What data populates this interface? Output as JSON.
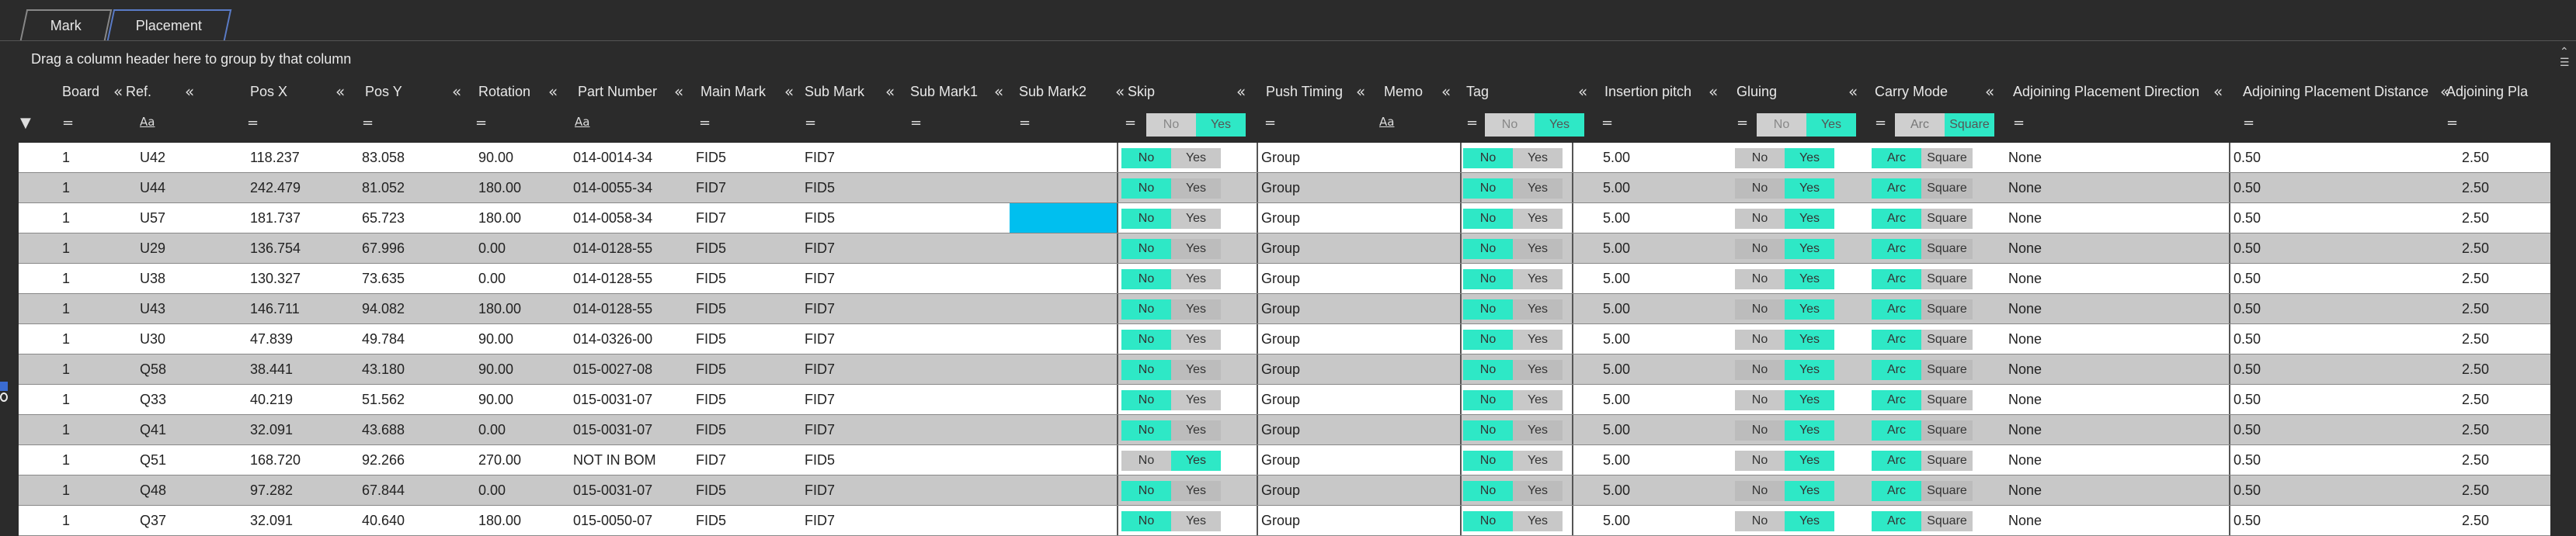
{
  "tabs": [
    {
      "label": "Mark"
    },
    {
      "label": "Placement"
    }
  ],
  "group_hint": "Drag a column header here to group by that column",
  "columns": [
    "Board",
    "Ref.",
    "Pos X",
    "Pos Y",
    "Rotation",
    "Part Number",
    "Main Mark",
    "Sub Mark",
    "Sub Mark1",
    "Sub Mark2",
    "Skip",
    "Push Timing",
    "Memo",
    "Tag",
    "Insertion pitch",
    "Gluing",
    "Carry Mode",
    "Adjoining Placement Direction",
    "Adjoining Placement Distance",
    "Adjoining Pla"
  ],
  "filter_row": {
    "text_filter_glyph": "Aa",
    "equals_glyph": "=",
    "no": "No",
    "yes": "Yes",
    "arc": "Arc",
    "square": "Square"
  },
  "row_labels": {
    "no": "No",
    "yes": "Yes",
    "arc": "Arc",
    "square": "Square"
  },
  "rows": [
    {
      "board": "1",
      "ref": "U42",
      "posx": "118.237",
      "posy": "83.058",
      "rot": "90.00",
      "part": "014-0014-34",
      "main": "FID5",
      "sub": "FID7",
      "skip": "No",
      "push": "Group",
      "tag": "No",
      "pitch": "5.00",
      "glue": "Yes",
      "carry": "Arc",
      "dir": "None",
      "dist": "0.50",
      "pla": "2.50",
      "sub2_highlight": false
    },
    {
      "board": "1",
      "ref": "U44",
      "posx": "242.479",
      "posy": "81.052",
      "rot": "180.00",
      "part": "014-0055-34",
      "main": "FID7",
      "sub": "FID5",
      "skip": "No",
      "push": "Group",
      "tag": "No",
      "pitch": "5.00",
      "glue": "Yes",
      "carry": "Arc",
      "dir": "None",
      "dist": "0.50",
      "pla": "2.50",
      "sub2_highlight": false
    },
    {
      "board": "1",
      "ref": "U57",
      "posx": "181.737",
      "posy": "65.723",
      "rot": "180.00",
      "part": "014-0058-34",
      "main": "FID7",
      "sub": "FID5",
      "skip": "No",
      "push": "Group",
      "tag": "No",
      "pitch": "5.00",
      "glue": "Yes",
      "carry": "Arc",
      "dir": "None",
      "dist": "0.50",
      "pla": "2.50",
      "sub2_highlight": true
    },
    {
      "board": "1",
      "ref": "U29",
      "posx": "136.754",
      "posy": "67.996",
      "rot": "0.00",
      "part": "014-0128-55",
      "main": "FID5",
      "sub": "FID7",
      "skip": "No",
      "push": "Group",
      "tag": "No",
      "pitch": "5.00",
      "glue": "Yes",
      "carry": "Arc",
      "dir": "None",
      "dist": "0.50",
      "pla": "2.50",
      "sub2_highlight": false
    },
    {
      "board": "1",
      "ref": "U38",
      "posx": "130.327",
      "posy": "73.635",
      "rot": "0.00",
      "part": "014-0128-55",
      "main": "FID5",
      "sub": "FID7",
      "skip": "No",
      "push": "Group",
      "tag": "No",
      "pitch": "5.00",
      "glue": "Yes",
      "carry": "Arc",
      "dir": "None",
      "dist": "0.50",
      "pla": "2.50",
      "sub2_highlight": false
    },
    {
      "board": "1",
      "ref": "U43",
      "posx": "146.711",
      "posy": "94.082",
      "rot": "180.00",
      "part": "014-0128-55",
      "main": "FID5",
      "sub": "FID7",
      "skip": "No",
      "push": "Group",
      "tag": "No",
      "pitch": "5.00",
      "glue": "Yes",
      "carry": "Arc",
      "dir": "None",
      "dist": "0.50",
      "pla": "2.50",
      "sub2_highlight": false
    },
    {
      "board": "1",
      "ref": "U30",
      "posx": "47.839",
      "posy": "49.784",
      "rot": "90.00",
      "part": "014-0326-00",
      "main": "FID5",
      "sub": "FID7",
      "skip": "No",
      "push": "Group",
      "tag": "No",
      "pitch": "5.00",
      "glue": "Yes",
      "carry": "Arc",
      "dir": "None",
      "dist": "0.50",
      "pla": "2.50",
      "sub2_highlight": false
    },
    {
      "board": "1",
      "ref": "Q58",
      "posx": "38.441",
      "posy": "43.180",
      "rot": "90.00",
      "part": "015-0027-08",
      "main": "FID5",
      "sub": "FID7",
      "skip": "No",
      "push": "Group",
      "tag": "No",
      "pitch": "5.00",
      "glue": "Yes",
      "carry": "Arc",
      "dir": "None",
      "dist": "0.50",
      "pla": "2.50",
      "sub2_highlight": false
    },
    {
      "board": "1",
      "ref": "Q33",
      "posx": "40.219",
      "posy": "51.562",
      "rot": "90.00",
      "part": "015-0031-07",
      "main": "FID5",
      "sub": "FID7",
      "skip": "No",
      "push": "Group",
      "tag": "No",
      "pitch": "5.00",
      "glue": "Yes",
      "carry": "Arc",
      "dir": "None",
      "dist": "0.50",
      "pla": "2.50",
      "sub2_highlight": false
    },
    {
      "board": "1",
      "ref": "Q41",
      "posx": "32.091",
      "posy": "43.688",
      "rot": "0.00",
      "part": "015-0031-07",
      "main": "FID5",
      "sub": "FID7",
      "skip": "No",
      "push": "Group",
      "tag": "No",
      "pitch": "5.00",
      "glue": "Yes",
      "carry": "Arc",
      "dir": "None",
      "dist": "0.50",
      "pla": "2.50",
      "sub2_highlight": false
    },
    {
      "board": "1",
      "ref": "Q51",
      "posx": "168.720",
      "posy": "92.266",
      "rot": "270.00",
      "part": "NOT IN BOM",
      "main": "FID7",
      "sub": "FID5",
      "skip": "Yes",
      "push": "Group",
      "tag": "No",
      "pitch": "5.00",
      "glue": "Yes",
      "carry": "Arc",
      "dir": "None",
      "dist": "0.50",
      "pla": "2.50",
      "sub2_highlight": false
    },
    {
      "board": "1",
      "ref": "Q48",
      "posx": "97.282",
      "posy": "67.844",
      "rot": "0.00",
      "part": "015-0031-07",
      "main": "FID5",
      "sub": "FID7",
      "skip": "No",
      "push": "Group",
      "tag": "No",
      "pitch": "5.00",
      "glue": "Yes",
      "carry": "Arc",
      "dir": "None",
      "dist": "0.50",
      "pla": "2.50",
      "sub2_highlight": false
    },
    {
      "board": "1",
      "ref": "Q37",
      "posx": "32.091",
      "posy": "40.640",
      "rot": "180.00",
      "part": "015-0050-07",
      "main": "FID5",
      "sub": "FID7",
      "skip": "No",
      "push": "Group",
      "tag": "No",
      "pitch": "5.00",
      "glue": "Yes",
      "carry": "Arc",
      "dir": "None",
      "dist": "0.50",
      "pla": "2.50",
      "sub2_highlight": false
    }
  ],
  "colors": {
    "accent": "#2ee8c6",
    "highlight": "#00bfef",
    "bg": "#2b2b2b"
  }
}
